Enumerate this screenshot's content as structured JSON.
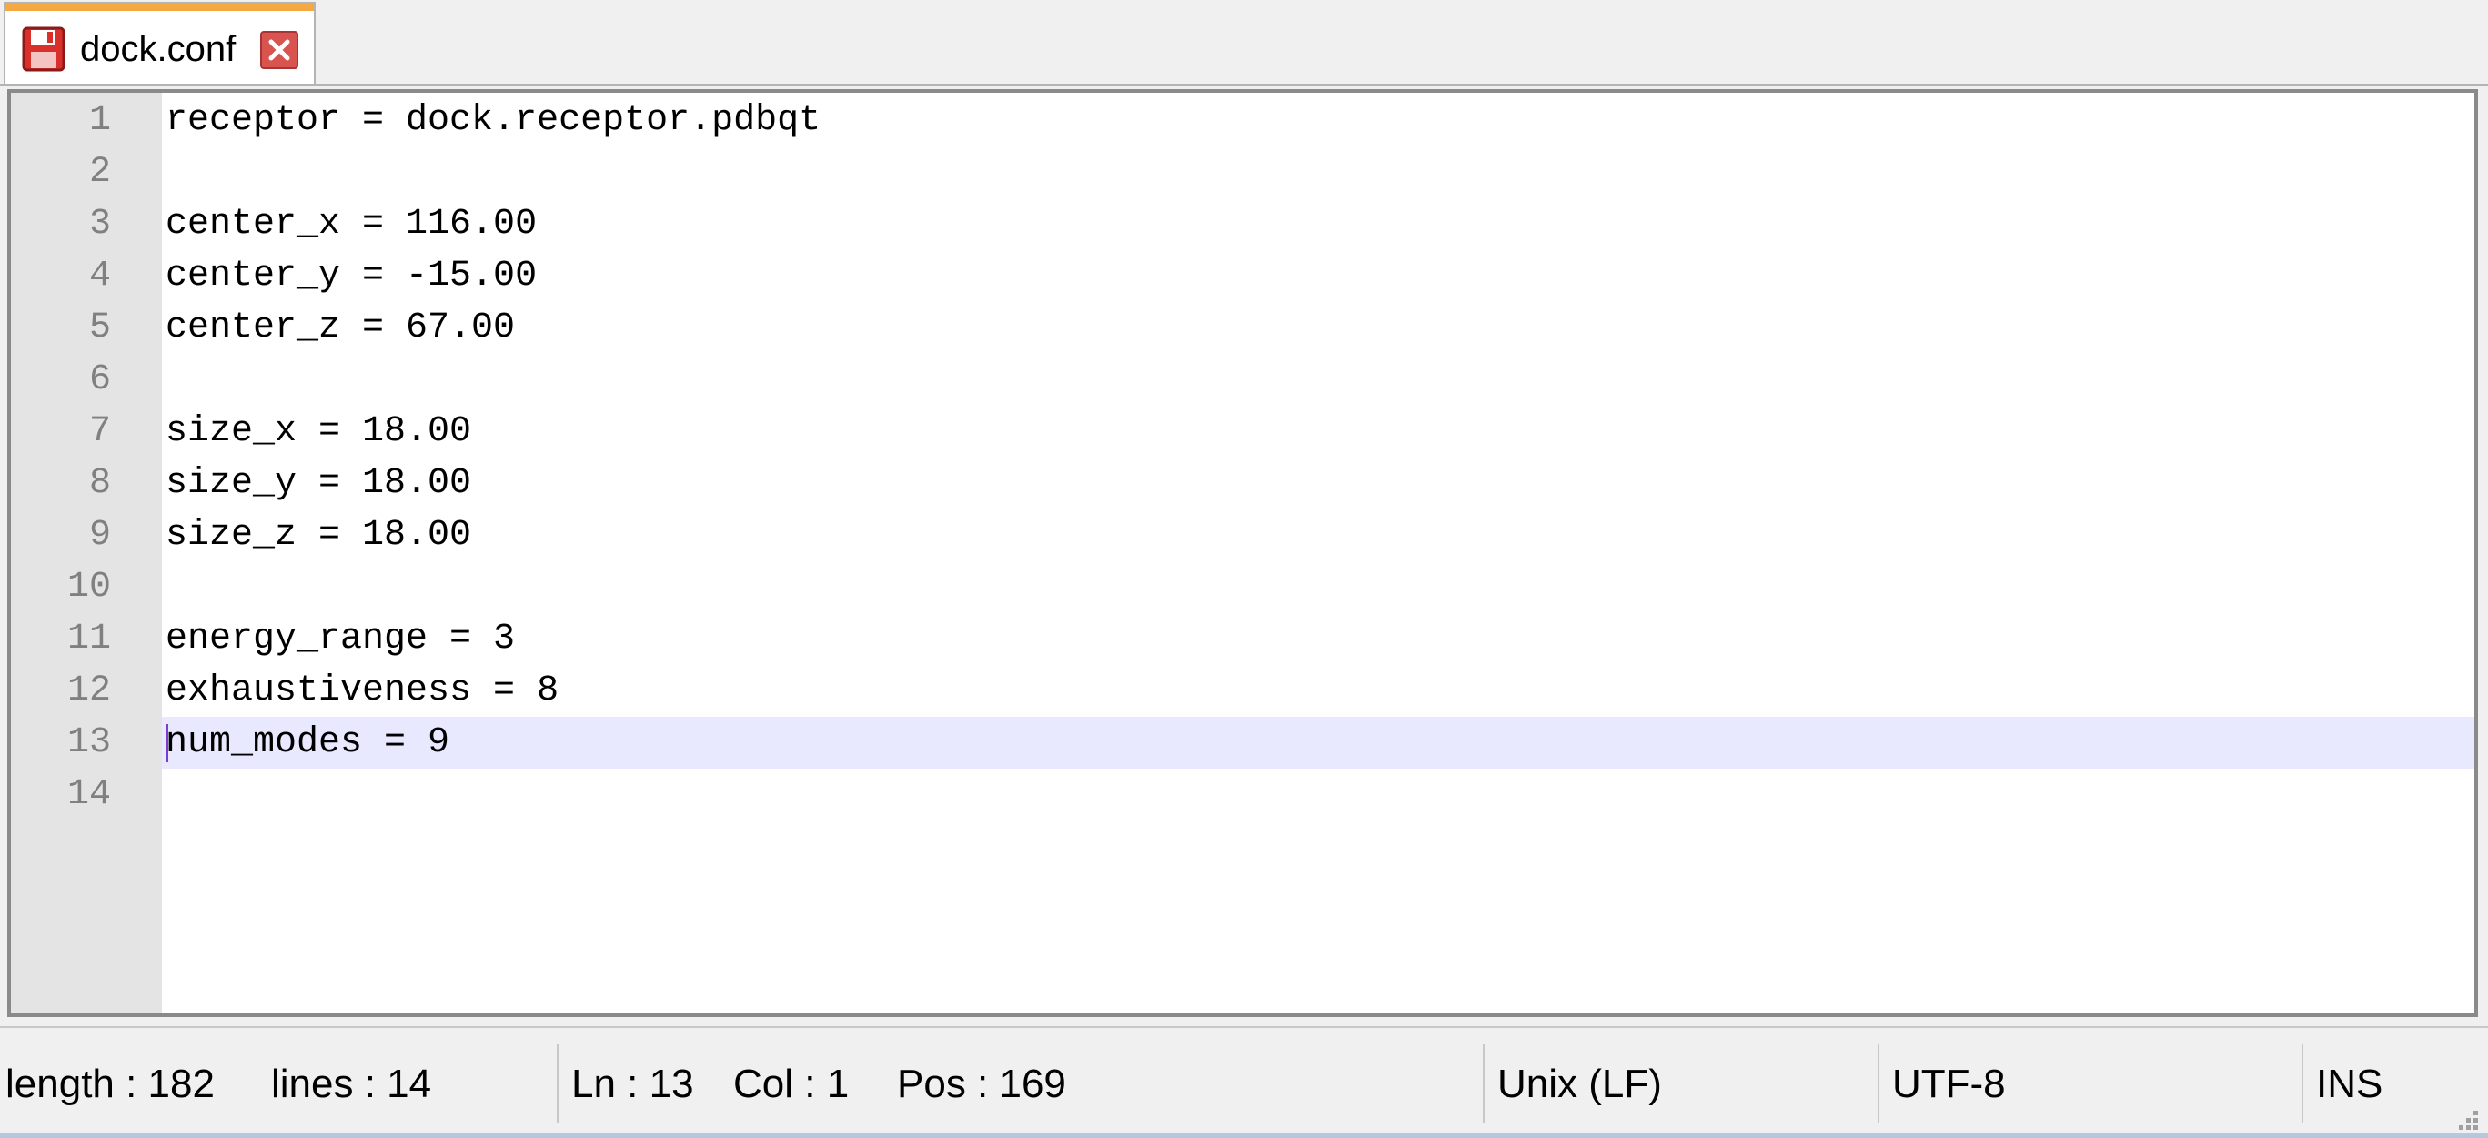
{
  "tab": {
    "title": "dock.conf",
    "accent_color": "#f5a742",
    "icon": "floppy-disk-icon",
    "close_icon": "close-icon"
  },
  "editor": {
    "lines": [
      {
        "n": "1",
        "text": "receptor = dock.receptor.pdbqt"
      },
      {
        "n": "2",
        "text": ""
      },
      {
        "n": "3",
        "text": "center_x = 116.00"
      },
      {
        "n": "4",
        "text": "center_y = -15.00"
      },
      {
        "n": "5",
        "text": "center_z = 67.00"
      },
      {
        "n": "6",
        "text": ""
      },
      {
        "n": "7",
        "text": "size_x = 18.00"
      },
      {
        "n": "8",
        "text": "size_y = 18.00"
      },
      {
        "n": "9",
        "text": "size_z = 18.00"
      },
      {
        "n": "10",
        "text": ""
      },
      {
        "n": "11",
        "text": "energy_range = 3"
      },
      {
        "n": "12",
        "text": "exhaustiveness = 8"
      },
      {
        "n": "13",
        "text": "num_modes = 9"
      },
      {
        "n": "14",
        "text": ""
      }
    ],
    "current_line": 13,
    "current_line_color": "#e8e8ff"
  },
  "status": {
    "length": "length : 182",
    "lines": "lines : 14",
    "ln": "Ln : 13",
    "col": "Col : 1",
    "pos": "Pos : 169",
    "eol": "Unix (LF)",
    "encoding": "UTF-8",
    "mode": "INS"
  }
}
